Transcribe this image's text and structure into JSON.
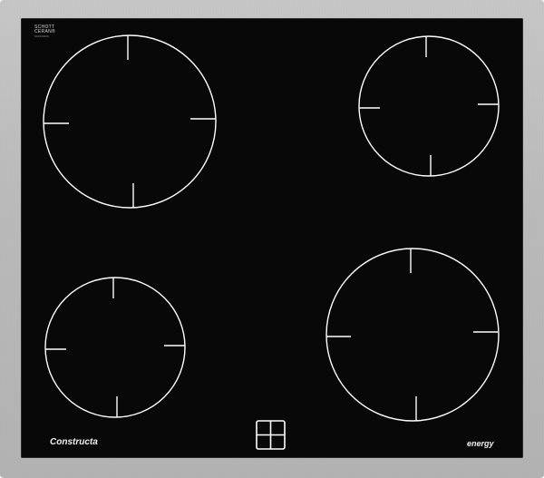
{
  "panel": {
    "frame_color": "#bdbdbd",
    "glass_color": "#080808",
    "line_color": "#ffffff"
  },
  "logos": {
    "manufacturer_mark_line1": "SCHOTT",
    "manufacturer_mark_line2": "CERAN®",
    "manufacturer_mark_small": "00000000",
    "brand": "Constructa",
    "energy": "energy"
  },
  "burners": [
    {
      "name": "burner-front-left-large",
      "size": "large"
    },
    {
      "name": "burner-rear-right",
      "size": "medium"
    },
    {
      "name": "burner-front-left-small",
      "size": "small"
    },
    {
      "name": "burner-front-right-large",
      "size": "large"
    }
  ],
  "control_icon": "four-zone-icon"
}
